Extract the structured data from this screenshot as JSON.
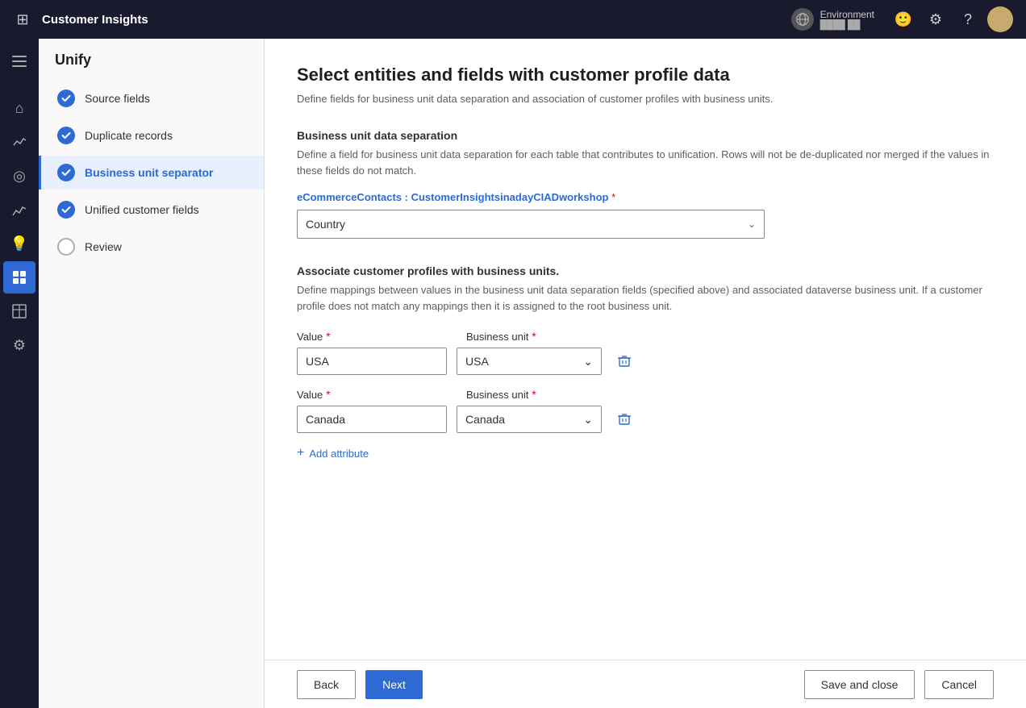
{
  "app": {
    "title": "Customer Insights",
    "page_title": "Unify"
  },
  "topnav": {
    "title": "Customer Insights",
    "environment_label": "Environment",
    "environment_sub": "████ ██"
  },
  "sidebar": {
    "title": "Unify",
    "steps": [
      {
        "id": "source-fields",
        "label": "Source fields",
        "status": "completed"
      },
      {
        "id": "duplicate-records",
        "label": "Duplicate records",
        "status": "completed"
      },
      {
        "id": "business-unit-separator",
        "label": "Business unit separator",
        "status": "active"
      },
      {
        "id": "unified-customer-fields",
        "label": "Unified customer fields",
        "status": "completed"
      },
      {
        "id": "review",
        "label": "Review",
        "status": "empty"
      }
    ]
  },
  "main": {
    "title": "Select entities and fields with customer profile data",
    "subtitle": "Define fields for business unit data separation and association of customer profiles with business units.",
    "business_unit_section": {
      "title": "Business unit data separation",
      "description": "Define a field for business unit data separation for each table that contributes to unification. Rows will not be de-duplicated nor merged if the values in these fields do not match.",
      "entity_label_prefix": "eCommerceContacts : CustomerInsightsinadayCIADworkshop",
      "required_indicator": "*",
      "dropdown_value": "Country",
      "dropdown_arrow": "⌄"
    },
    "associate_section": {
      "title": "Associate customer profiles with business units.",
      "description": "Define mappings between values in the business unit data separation fields (specified above) and associated dataverse business unit. If a customer profile does not match any mappings then it is assigned to the root business unit.",
      "value_label": "Value",
      "business_unit_label": "Business unit",
      "required_indicator": "*",
      "rows": [
        {
          "value": "USA",
          "business_unit": "USA"
        },
        {
          "value": "Canada",
          "business_unit": "Canada"
        }
      ],
      "add_attribute_label": "Add attribute"
    }
  },
  "footer": {
    "back_label": "Back",
    "next_label": "Next",
    "save_close_label": "Save and close",
    "cancel_label": "Cancel"
  },
  "icons": {
    "grid": "⊞",
    "home": "⌂",
    "analytics": "📊",
    "target": "◎",
    "chart": "📈",
    "bulb": "💡",
    "segments": "⬡",
    "table": "▦",
    "settings": "⚙",
    "chevron_down": "⌄",
    "delete": "🗑",
    "plus": "+"
  }
}
